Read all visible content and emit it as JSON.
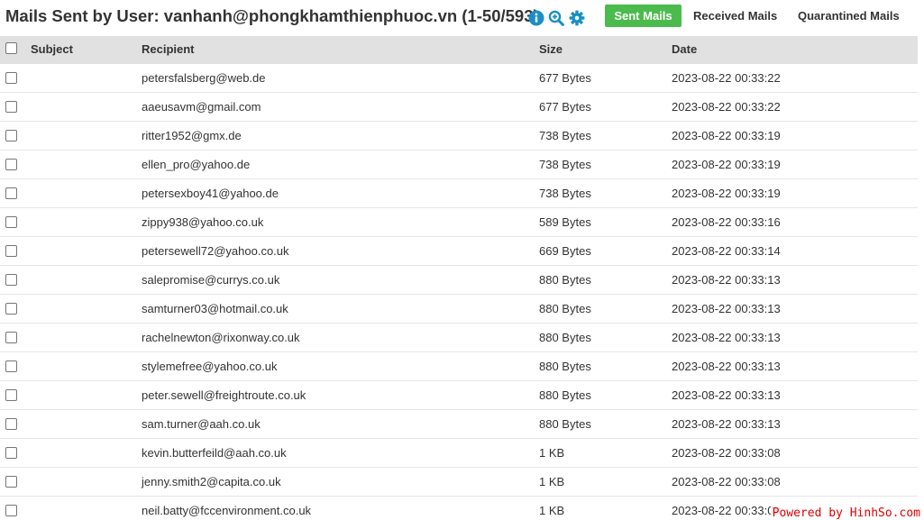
{
  "header": {
    "title": "Mails Sent by User: vanhanh@phongkhamthienphuoc.vn (1-50/593)",
    "icons": [
      "info-icon",
      "zoom-icon",
      "gear-icon"
    ],
    "accent_color": "#1a8fc4"
  },
  "tabs": [
    {
      "label": "Sent Mails",
      "active": true
    },
    {
      "label": "Received Mails",
      "active": false
    },
    {
      "label": "Quarantined Mails",
      "active": false
    }
  ],
  "active_tab_color": "#4cbb4d",
  "table": {
    "columns": [
      "Subject",
      "Recipient",
      "Size",
      "Date"
    ],
    "rows": [
      {
        "subject": "",
        "recipient": "petersfalsberg@web.de",
        "size": "677 Bytes",
        "date": "2023-08-22 00:33:22"
      },
      {
        "subject": "",
        "recipient": "aaeusavm@gmail.com",
        "size": "677 Bytes",
        "date": "2023-08-22 00:33:22"
      },
      {
        "subject": "",
        "recipient": "ritter1952@gmx.de",
        "size": "738 Bytes",
        "date": "2023-08-22 00:33:19"
      },
      {
        "subject": "",
        "recipient": "ellen_pro@yahoo.de",
        "size": "738 Bytes",
        "date": "2023-08-22 00:33:19"
      },
      {
        "subject": "",
        "recipient": "petersexboy41@yahoo.de",
        "size": "738 Bytes",
        "date": "2023-08-22 00:33:19"
      },
      {
        "subject": "",
        "recipient": "zippy938@yahoo.co.uk",
        "size": "589 Bytes",
        "date": "2023-08-22 00:33:16"
      },
      {
        "subject": "",
        "recipient": "petersewell72@yahoo.co.uk",
        "size": "669 Bytes",
        "date": "2023-08-22 00:33:14"
      },
      {
        "subject": "",
        "recipient": "salepromise@currys.co.uk",
        "size": "880 Bytes",
        "date": "2023-08-22 00:33:13"
      },
      {
        "subject": "",
        "recipient": "samturner03@hotmail.co.uk",
        "size": "880 Bytes",
        "date": "2023-08-22 00:33:13"
      },
      {
        "subject": "",
        "recipient": "rachelnewton@rixonway.co.uk",
        "size": "880 Bytes",
        "date": "2023-08-22 00:33:13"
      },
      {
        "subject": "",
        "recipient": "stylemefree@yahoo.co.uk",
        "size": "880 Bytes",
        "date": "2023-08-22 00:33:13"
      },
      {
        "subject": "",
        "recipient": "peter.sewell@freightroute.co.uk",
        "size": "880 Bytes",
        "date": "2023-08-22 00:33:13"
      },
      {
        "subject": "",
        "recipient": "sam.turner@aah.co.uk",
        "size": "880 Bytes",
        "date": "2023-08-22 00:33:13"
      },
      {
        "subject": "",
        "recipient": "kevin.butterfeild@aah.co.uk",
        "size": "1 KB",
        "date": "2023-08-22 00:33:08"
      },
      {
        "subject": "",
        "recipient": "jenny.smith2@capita.co.uk",
        "size": "1 KB",
        "date": "2023-08-22 00:33:08"
      },
      {
        "subject": "",
        "recipient": "neil.batty@fccenvironment.co.uk",
        "size": "1 KB",
        "date": "2023-08-22 00:33:08"
      }
    ]
  },
  "watermark": "Powered by HinhSo.com"
}
